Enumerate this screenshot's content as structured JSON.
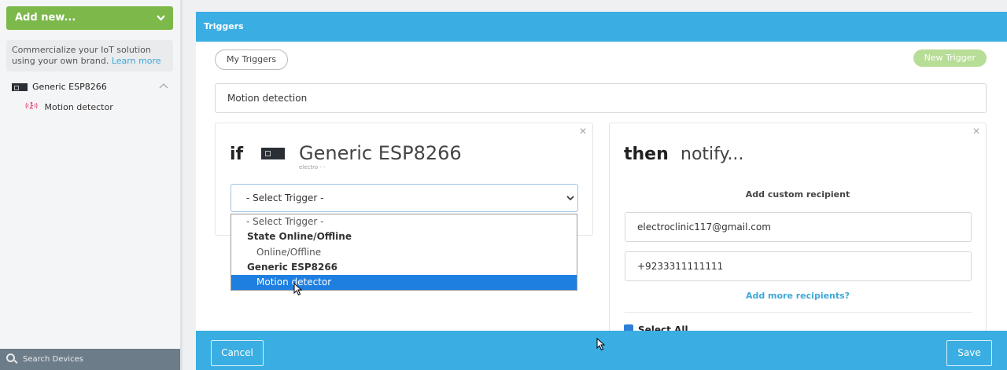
{
  "sidebar": {
    "add_new_label": "Add new...",
    "add_new_icon": "chevron-down-icon",
    "promo_text": "Commercialize your IoT solution using your own brand.",
    "promo_link": "Learn more",
    "device_name": "Generic ESP8266",
    "device_icon": "chip-icon",
    "sensor_name": "Motion detector",
    "sensor_icon": "motion-icon",
    "search_label": "Search Devices",
    "colors": {
      "add_new_bg": "#7cb84a",
      "link": "#3fa8d8",
      "search_bar_bg": "#6d7c89"
    }
  },
  "modal": {
    "title": "Triggers",
    "my_triggers_label": "My Triggers",
    "new_trigger_label": "New Trigger",
    "trigger_name": "Motion detection",
    "if_panel": {
      "if_label": "if",
      "device_name": "Generic ESP8266",
      "device_sub": "electro -    -",
      "select_value": "- Select Trigger -"
    },
    "then_panel": {
      "then_label": "then",
      "notify_label": "notify...",
      "add_custom_recipient": "Add custom recipient",
      "email_value": "electroclinic117@gmail.com",
      "phone_value": "+9233311111111",
      "add_more_recipients": "Add more recipients?",
      "select_all_label": "Select All"
    },
    "dropdown": {
      "options": [
        {
          "label": "- Select Trigger -",
          "kind": "placeholder"
        },
        {
          "label": "State Online/Offline",
          "kind": "group"
        },
        {
          "label": "Online/Offline",
          "kind": "option"
        },
        {
          "label": "Generic ESP8266",
          "kind": "group"
        },
        {
          "label": "Motion detector",
          "kind": "option",
          "selected": true
        }
      ]
    },
    "footer": {
      "cancel_label": "Cancel",
      "save_label": "Save"
    },
    "colors": {
      "header_bg": "#3aaee2",
      "new_trigger_bg": "#b8dd97",
      "selected_option_bg": "#1e7fe0"
    }
  }
}
